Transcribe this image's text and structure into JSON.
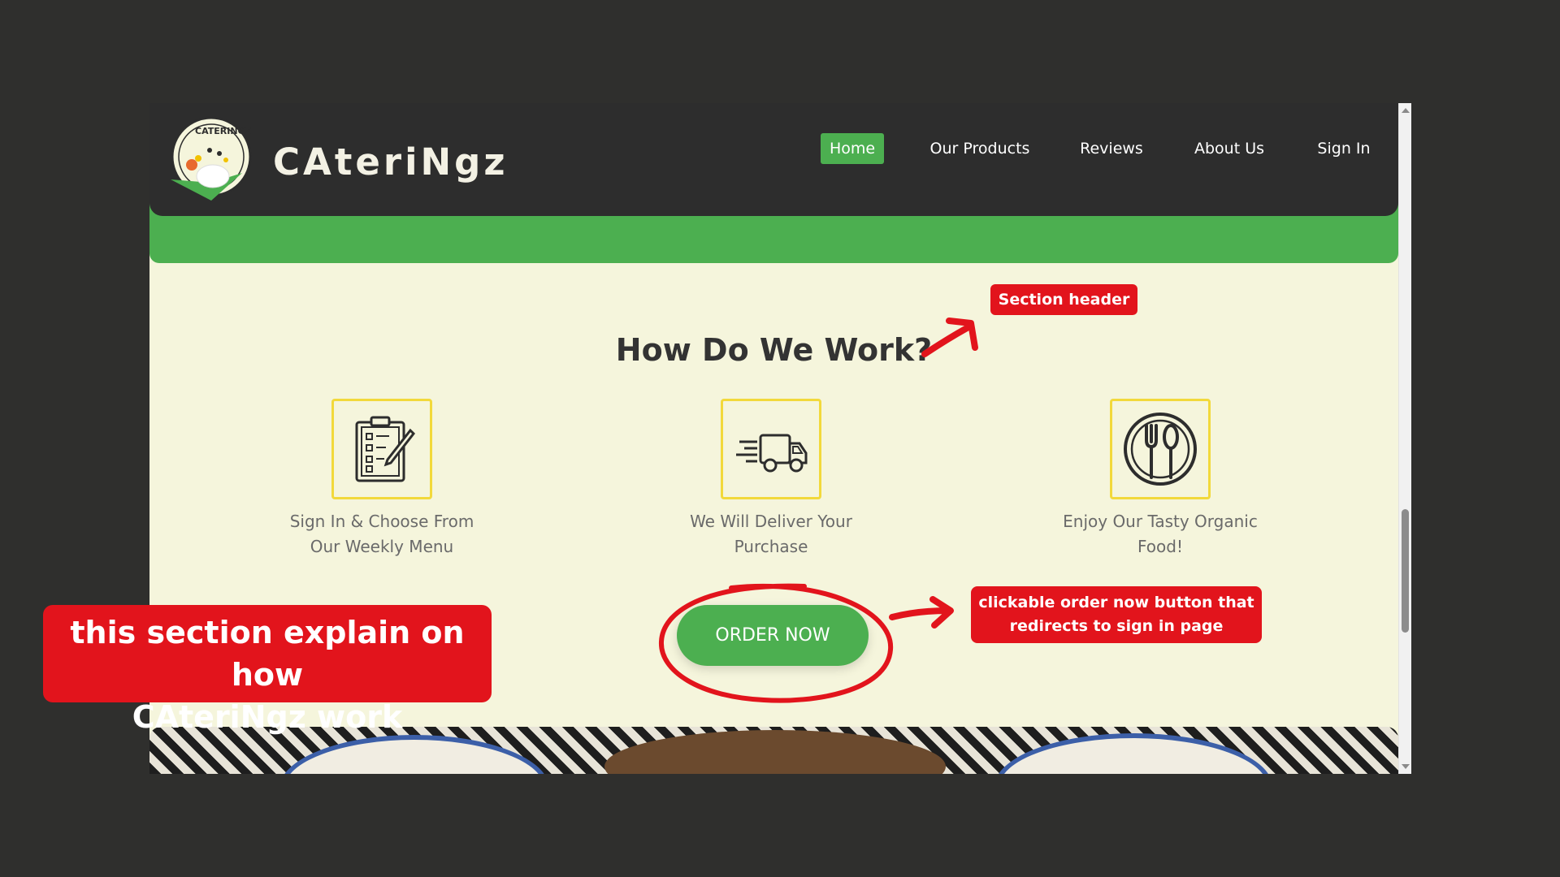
{
  "navbar": {
    "brand": "CAteriNgz",
    "logo_text": "CATERINGZ",
    "links": [
      {
        "label": "Home",
        "active": true
      },
      {
        "label": "Our Products",
        "active": false
      },
      {
        "label": "Reviews",
        "active": false
      },
      {
        "label": "About Us",
        "active": false
      },
      {
        "label": "Sign In",
        "active": false
      }
    ]
  },
  "section": {
    "title": "How Do We Work?",
    "steps": [
      {
        "icon": "checklist-icon",
        "line1": "Sign In & Choose From",
        "line2": "Our Weekly Menu"
      },
      {
        "icon": "delivery-truck-icon",
        "line1": "We Will Deliver Your",
        "line2": "Purchase"
      },
      {
        "icon": "plate-cutlery-icon",
        "line1": "Enjoy Our Tasty Organic",
        "line2": "Food!"
      }
    ],
    "order_button": "ORDER NOW"
  },
  "annotations": {
    "section_header": "Section header",
    "order_note_line1": "clickable order now button that",
    "order_note_line2": "redirects to sign in page",
    "explain_line1": "this section explain on how",
    "explain_line2": "CAteriNgz work"
  },
  "colors": {
    "accent_green": "#4caf50",
    "nav_dark": "#2d2d2d",
    "page_bg": "#f5f5dc",
    "icon_border": "#f2d93b",
    "annotation_red": "#e2141c"
  }
}
